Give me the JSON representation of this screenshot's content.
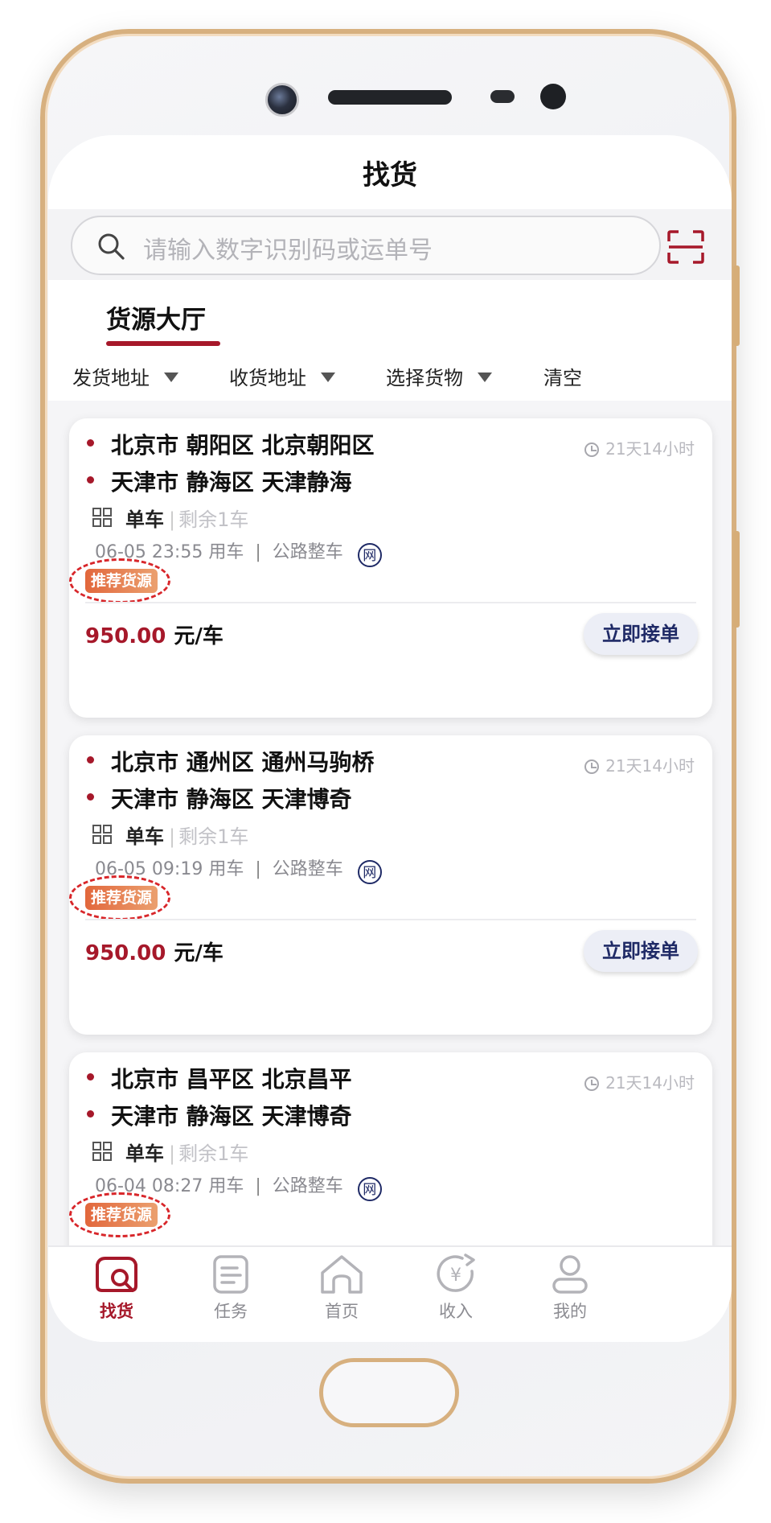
{
  "header": {
    "title": "找货"
  },
  "search": {
    "placeholder": "请输入数字识别码或运单号"
  },
  "tabs": [
    {
      "label": "货源大厅",
      "active": true
    }
  ],
  "filters": [
    {
      "label": "发货地址"
    },
    {
      "label": "收货地址"
    },
    {
      "label": "选择货物"
    },
    {
      "label": "清空"
    }
  ],
  "cards": [
    {
      "origin": "北京市 朝阳区 北京朝阳区",
      "destination": "天津市 静海区 天津静海",
      "remaining_time": "21天14小时",
      "vehicle": "单车",
      "remaining": "剩余1车",
      "time_text": "06-05 23:55 用车",
      "transport": "公路整车",
      "net_icon_text": "网",
      "tag": "推荐货源",
      "price": "950.00",
      "price_unit": "元/车",
      "button": "立即接单"
    },
    {
      "origin": "北京市 通州区 通州马驹桥",
      "destination": "天津市 静海区 天津博奇",
      "remaining_time": "21天14小时",
      "vehicle": "单车",
      "remaining": "剩余1车",
      "time_text": "06-05 09:19 用车",
      "transport": "公路整车",
      "net_icon_text": "网",
      "tag": "推荐货源",
      "price": "950.00",
      "price_unit": "元/车",
      "button": "立即接单"
    },
    {
      "origin": "北京市 昌平区 北京昌平",
      "destination": "天津市 静海区 天津博奇",
      "remaining_time": "21天14小时",
      "vehicle": "单车",
      "remaining": "剩余1车",
      "time_text": "06-04 08:27 用车",
      "transport": "公路整车",
      "net_icon_text": "网",
      "tag": "推荐货源"
    }
  ],
  "nav": [
    {
      "label": "找货",
      "icon": "find-cargo-icon",
      "active": true
    },
    {
      "label": "任务",
      "icon": "task-icon"
    },
    {
      "label": "首页",
      "icon": "home-icon"
    },
    {
      "label": "收入",
      "icon": "income-icon"
    },
    {
      "label": "我的",
      "icon": "profile-icon"
    }
  ],
  "colors": {
    "accent": "#a6182a",
    "tag": "#e2673c",
    "navy": "#1f2a66"
  }
}
